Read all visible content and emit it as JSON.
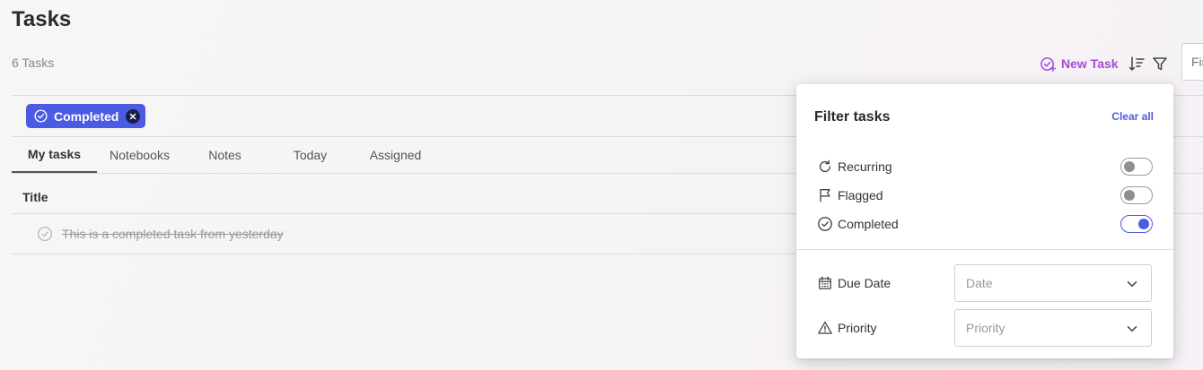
{
  "page": {
    "title": "Tasks",
    "count": "6 Tasks"
  },
  "toolbar": {
    "new_task_label": "New Task",
    "sort_icon": "sort-icon",
    "filter_icon": "filter-icon",
    "find_placeholder": "Find"
  },
  "active_filter": {
    "label": "Completed",
    "icon": "check-circle-icon",
    "close_icon": "close-icon"
  },
  "tabs": [
    {
      "label": "My tasks",
      "active": true
    },
    {
      "label": "Notebooks",
      "active": false
    },
    {
      "label": "Notes",
      "active": false
    },
    {
      "label": "Today",
      "active": false
    },
    {
      "label": "Assigned",
      "active": false
    }
  ],
  "table": {
    "column_title": "Title",
    "rows": [
      {
        "title": "This is a completed task from yesterday",
        "completed": true
      }
    ]
  },
  "filter_panel": {
    "title": "Filter tasks",
    "clear_all": "Clear all",
    "toggles": [
      {
        "label": "Recurring",
        "icon": "repeat-icon",
        "on": false
      },
      {
        "label": "Flagged",
        "icon": "flag-icon",
        "on": false
      },
      {
        "label": "Completed",
        "icon": "check-circle-icon",
        "on": true
      }
    ],
    "selects": [
      {
        "label": "Due Date",
        "icon": "calendar-icon",
        "placeholder": "Date"
      },
      {
        "label": "Priority",
        "icon": "warning-icon",
        "placeholder": "Priority"
      }
    ]
  },
  "colors": {
    "accent": "#4c5be3",
    "new_task": "#a64cd8"
  }
}
